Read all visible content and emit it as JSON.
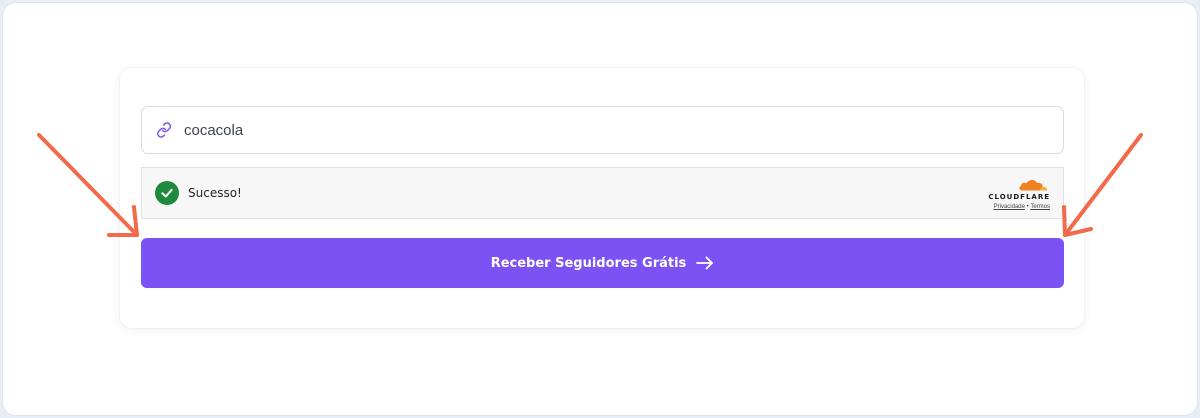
{
  "form": {
    "input": {
      "value": "cocacola",
      "icon": "link-icon"
    },
    "captcha": {
      "status_text": "Sucesso!",
      "status_icon": "check-circle-icon",
      "brand": "CLOUDFLARE",
      "privacy_link": "Privacidade",
      "separator": "•",
      "terms_link": "Termos"
    },
    "submit": {
      "label": "Receber Seguidores Grátis",
      "icon": "arrow-right-icon"
    }
  },
  "colors": {
    "accent": "#7b52f4",
    "success": "#1f8a3c",
    "annotation": "#f26a4b",
    "cloudflare": "#f38020"
  }
}
